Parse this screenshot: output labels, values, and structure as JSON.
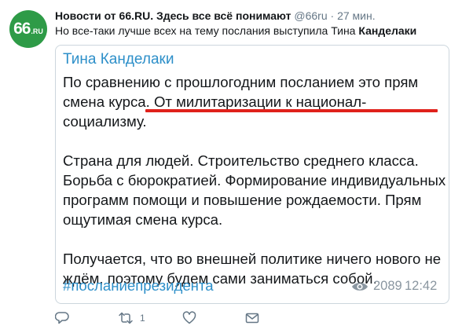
{
  "author": {
    "avatar_text_big": "66",
    "avatar_text_small": ".RU",
    "name": "Новости от 66.RU. Здесь все всё понимают",
    "handle": "@66ru",
    "separator": "·",
    "time": "27 мин."
  },
  "tweet": {
    "text": "Но все-таки лучше всех на тему послания выступила Тина",
    "text_bold": "Канделаки"
  },
  "card": {
    "author": "Тина Канделаки",
    "paragraphs": [
      "По сравнению с прошлогодним посланием это прям смена курса. От милитаризации к национал-социализму.",
      "Страна для людей. Строительство среднего класса. Борьба с бюрократией. Формирование индивидуальных программ помощи и повышение рождаемости. Прям ощутимая смена курса.",
      "Получается, что во внешней политике ничего нового не ждём, поэтому будем сами заниматься собой."
    ],
    "hashtag": "#посланиепрезидента",
    "views": "2089",
    "time": "12:42"
  },
  "actions": {
    "retweet_count": "1"
  },
  "colors": {
    "link": "#2d8fc9",
    "underline": "#e0211b",
    "avatar_bg": "#2e9b47",
    "muted": "#657786"
  },
  "icons": [
    "reply-icon",
    "retweet-icon",
    "like-icon",
    "direct-message-icon",
    "eye-icon"
  ]
}
